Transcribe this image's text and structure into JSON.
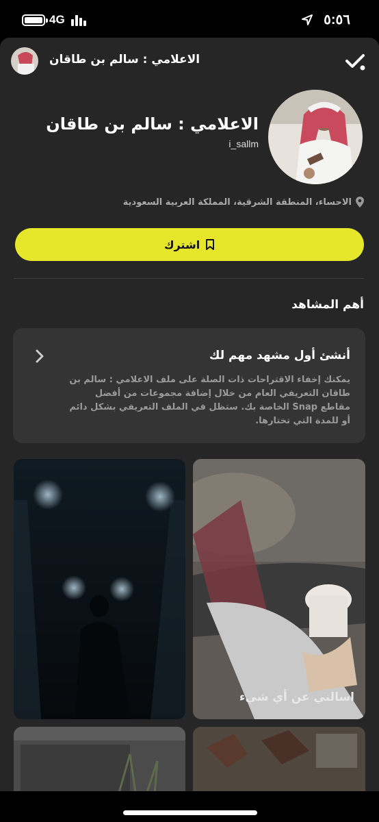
{
  "status_bar": {
    "network": "4G",
    "time": "٥:٥٦"
  },
  "header": {
    "title": "الاعلامي : سالم بن طاقان"
  },
  "profile": {
    "name": "الاعلامي : سالم بن طاقان",
    "username": "i_sallm",
    "location": "الاحساء، المنطقة الشرقية، المملكة العربية السعودية"
  },
  "subscribe": {
    "label": "اشترك"
  },
  "highlights": {
    "section_title": "أهم المشاهد",
    "card_title": "أنشئ أول مشهد مهم لك",
    "card_body": "يمكنك إخفاء الاقتراحات ذات الصلة على ملف الاعلامي : سالم بن طاقان التعريفي العام من خلال إضافة مجموعات من أفضل مقاطع Snap الخاصة بك. ستظل في الملف التعريفي بشكل دائم أو للمدة التي تختارها."
  },
  "tiles": [
    {
      "caption": "اسالني عن أي شيء"
    },
    {
      "caption": ""
    },
    {
      "caption": ""
    },
    {
      "caption": ""
    }
  ],
  "colors": {
    "accent": "#e6e62a",
    "sheet_bg": "#262626",
    "card_bg": "#343434"
  }
}
